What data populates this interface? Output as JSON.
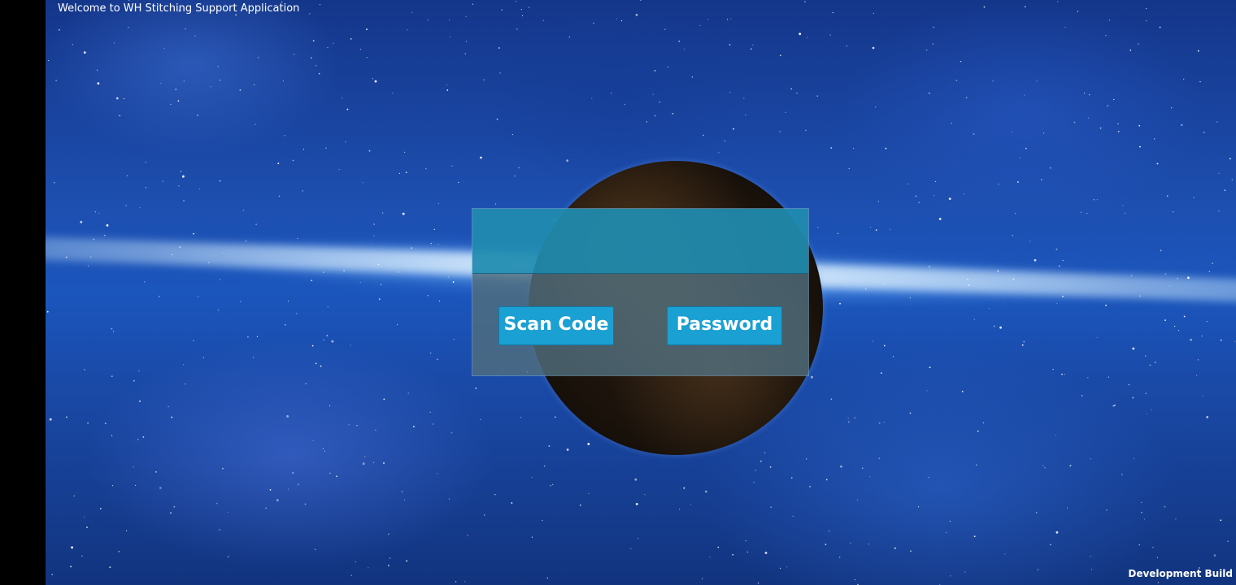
{
  "app": {
    "welcome_text": "Welcome to WH Stitching Support Application",
    "build_label": "Development Build"
  },
  "login_dialog": {
    "scan_code_label": "Scan Code",
    "password_label": "Password"
  },
  "colors": {
    "button_bg": "#1aa0d3",
    "dialog_header": "#208caf",
    "dialog_body": "#506e7d",
    "background": "#1d4fb0"
  }
}
